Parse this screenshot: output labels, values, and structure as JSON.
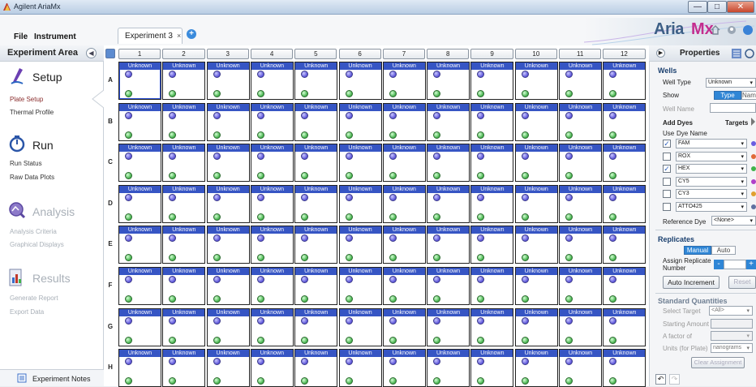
{
  "window": {
    "title": "Agilent AriaMx",
    "min": "—",
    "max": "□",
    "close": "✕"
  },
  "menu": [
    "File",
    "Instrument"
  ],
  "tab": {
    "label": "Experiment 3",
    "close": "×"
  },
  "brand": {
    "aria": "Aria",
    "mx": "Mx"
  },
  "sidebar": {
    "header": "Experiment Area",
    "sections": [
      {
        "title": "Setup",
        "items": [
          "Plate Setup",
          "Thermal Profile"
        ],
        "active": true
      },
      {
        "title": "Run",
        "items": [
          "Run Status",
          "Raw Data Plots"
        ],
        "active": true
      },
      {
        "title": "Analysis",
        "items": [
          "Analysis Criteria",
          "Graphical Displays"
        ],
        "active": false
      },
      {
        "title": "Results",
        "items": [
          "Generate Report",
          "Export Data"
        ],
        "active": false
      }
    ],
    "notes": "Experiment Notes"
  },
  "plate": {
    "columns": [
      "1",
      "2",
      "3",
      "4",
      "5",
      "6",
      "7",
      "8",
      "9",
      "10",
      "11",
      "12"
    ],
    "rows": [
      "A",
      "B",
      "C",
      "D",
      "E",
      "F",
      "G",
      "H"
    ],
    "well_type_label": "Unknown",
    "selected_well": "A1"
  },
  "properties": {
    "title": "Properties",
    "wells": {
      "heading": "Wells",
      "well_type_label": "Well Type",
      "well_type_value": "Unknown",
      "show_label": "Show",
      "show_options": [
        "Type",
        "Name"
      ],
      "well_name_label": "Well Name",
      "add_dyes": "Add Dyes",
      "targets": "Targets",
      "use_label": "Use",
      "dye_name_label": "Dye Name",
      "dyes": [
        {
          "name": "FAM",
          "checked": true,
          "color": "#6a5de0"
        },
        {
          "name": "ROX",
          "checked": false,
          "color": "#e06a3a"
        },
        {
          "name": "HEX",
          "checked": true,
          "color": "#3fb34a"
        },
        {
          "name": "CY5",
          "checked": false,
          "color": "#b040c8"
        },
        {
          "name": "CY3",
          "checked": false,
          "color": "#e0a030"
        },
        {
          "name": "ATTO425",
          "checked": false,
          "color": "#6070a0"
        }
      ],
      "reference_dye_label": "Reference Dye",
      "reference_dye_value": "<None>"
    },
    "replicates": {
      "heading": "Replicates",
      "modes": [
        "Manual",
        "Auto"
      ],
      "assign_label_1": "Assign Replicate",
      "assign_label_2": "Number",
      "auto_increment": "Auto Increment",
      "reset": "Reset"
    },
    "standard_quantities": {
      "heading": "Standard Quantities",
      "select_target_label": "Select Target",
      "select_target_value": "<All>",
      "starting_amount_label": "Starting Amount",
      "factor_label": "A factor of",
      "units_label": "Units (for Plate)",
      "units_value": "nanograms",
      "clear_assignment": "Clear Assignment"
    }
  }
}
